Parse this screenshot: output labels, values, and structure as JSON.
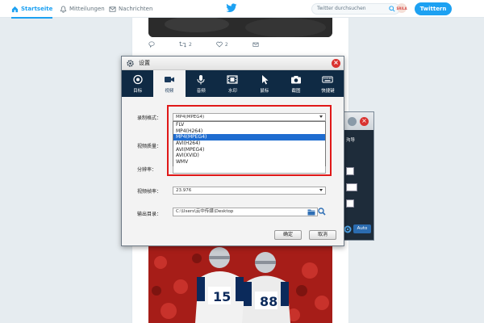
{
  "twitter": {
    "nav": {
      "home_label": "Startseite",
      "notifications_label": "Mitteilungen",
      "messages_label": "Nachrichten"
    },
    "search_placeholder": "Twitter durchsuchen",
    "avatar_text": "SRILA",
    "tweet_button_label": "Twittern",
    "tweet_actions": {
      "retweets": "2",
      "likes": "2"
    },
    "colors": {
      "brand": "#1da1f2"
    }
  },
  "dialog": {
    "title": "设置",
    "tabs": [
      {
        "label": "目标",
        "icon": "target-icon"
      },
      {
        "label": "视频",
        "icon": "video-camera-icon",
        "active": true
      },
      {
        "label": "音频",
        "icon": "microphone-icon"
      },
      {
        "label": "水印",
        "icon": "film-icon"
      },
      {
        "label": "鼠标",
        "icon": "mouse-cursor-icon"
      },
      {
        "label": "截图",
        "icon": "camera-icon"
      },
      {
        "label": "快捷键",
        "icon": "keyboard-icon"
      }
    ],
    "fields": {
      "format_label": "录制格式：",
      "format_value": "MP4(MPEG4)",
      "format_options": [
        "FLV",
        "MP4(H264)",
        "MP4(MPEG4)",
        "AVI(H264)",
        "AVI(MPEG4)",
        "AVI(XVID)",
        "WMV"
      ],
      "format_selected": "MP4(MPEG4)",
      "quality_label": "视频质量：",
      "resolution_label": "分辨率：",
      "framerate_label": "视频帧率：",
      "framerate_value": "23.976",
      "output_label": "输出目录：",
      "output_value": "C:\\Users\\云中传媒\\Desktop"
    },
    "buttons": {
      "ok_label": "确定",
      "cancel_label": "取消"
    },
    "colors": {
      "tab_bar": "#0f2a44",
      "highlight": "#e01818",
      "selection": "#1e6cd0"
    }
  },
  "side_window": {
    "text_snippet": "沟导",
    "auto_label": "Auto"
  }
}
